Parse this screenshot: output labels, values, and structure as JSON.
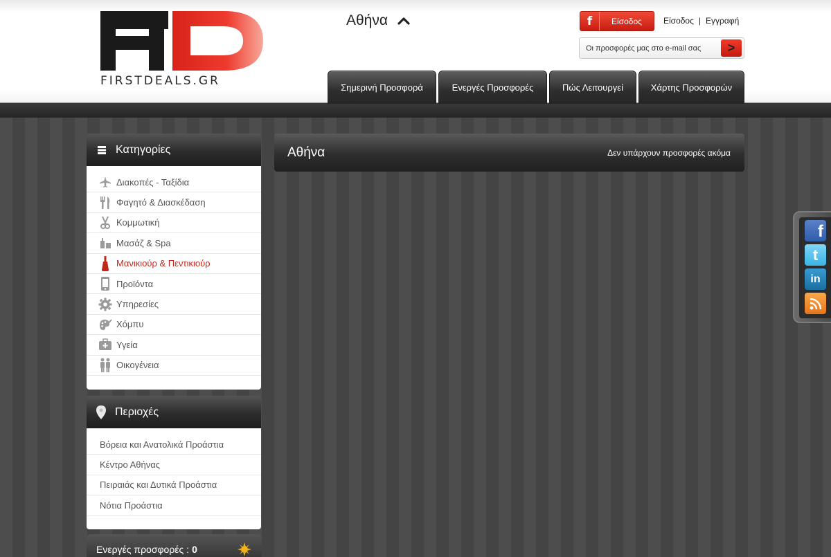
{
  "brand": {
    "logo_text": "FIRSTDEALS.GR",
    "accent": "#e8251b"
  },
  "header": {
    "city": "Αθήνα",
    "facebook_login_label": "Είσοδος",
    "login_link": "Είσοδος",
    "separator": "|",
    "register_link": "Εγγραφή",
    "newsletter_placeholder": "Οι προσφορές μας στο e-mail σας",
    "newsletter_button": ">"
  },
  "nav": {
    "tabs": [
      {
        "label": "Σημερινή Προσφορά"
      },
      {
        "label": "Ενεργές Προσφορές"
      },
      {
        "label": "Πώς Λειτουργεί"
      },
      {
        "label": "Χάρτης Προσφορών"
      }
    ]
  },
  "sidebar": {
    "categories_title": "Κατηγορίες",
    "categories": [
      {
        "label": "Διακοπές - Ταξίδια",
        "icon": "airplane-icon"
      },
      {
        "label": "Φαγητό & Διασκέδαση",
        "icon": "fork-knife-icon"
      },
      {
        "label": "Κομμωτική",
        "icon": "scissors-icon"
      },
      {
        "label": "Μασάζ & Spa",
        "icon": "spa-bottles-icon"
      },
      {
        "label": "Μανικιούρ & Πεντικιούρ",
        "icon": "nail-polish-icon",
        "active": true
      },
      {
        "label": "Προϊόντα",
        "icon": "phone-icon"
      },
      {
        "label": "Υπηρεσίες",
        "icon": "gear-icon"
      },
      {
        "label": "Χόμπυ",
        "icon": "palette-icon"
      },
      {
        "label": "Υγεία",
        "icon": "medical-kit-icon"
      },
      {
        "label": "Οικογένεια",
        "icon": "family-icon"
      }
    ],
    "areas_title": "Περιοχές",
    "areas": [
      {
        "label": "Βόρεια και Ανατολικά Προάστια"
      },
      {
        "label": "Κέντρο Αθήνας"
      },
      {
        "label": "Πειραιάς και Δυτικά Προάστια"
      },
      {
        "label": "Νότια Προάστια"
      }
    ],
    "active_deals_label": "Ενεργές προσφορές :",
    "active_deals_count": "0"
  },
  "main": {
    "title": "Αθήνα",
    "status": "Δεν υπάρχουν προσφορές ακόμα"
  },
  "social": [
    "facebook-icon",
    "twitter-icon",
    "linkedin-icon",
    "rss-icon"
  ]
}
